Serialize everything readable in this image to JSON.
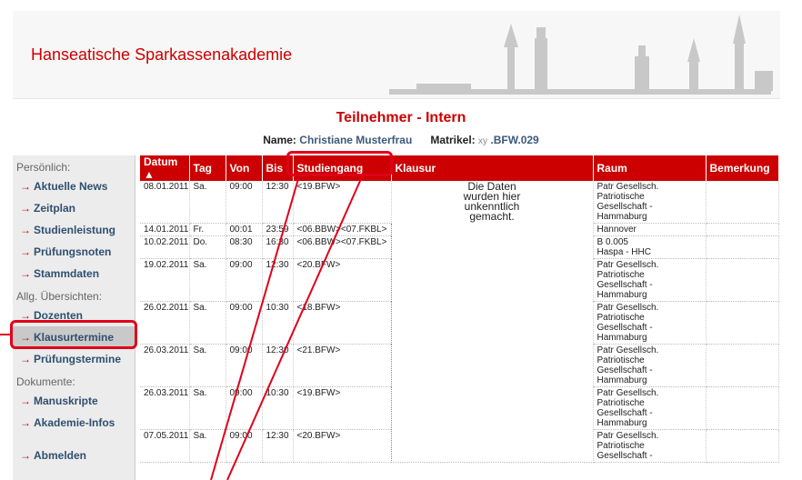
{
  "header": {
    "brand": "Hanseatische Sparkassenakademie"
  },
  "page_title": "Teilnehmer - Intern",
  "participant": {
    "name_label": "Name:",
    "name_value": "Christiane Musterfrau",
    "matrikel_label": "Matrikel:",
    "matrikel_prefix": "xy",
    "matrikel_value": ".BFW.029"
  },
  "sidebar": {
    "section_personal": "Persönlich:",
    "personal_items": [
      "Aktuelle News",
      "Zeitplan",
      "Studienleistung",
      "Prüfungsnoten",
      "Stammdaten"
    ],
    "section_overview": "Allg. Übersichten:",
    "overview_items": [
      "Dozenten",
      "Klausurtermine",
      "Prüfungstermine"
    ],
    "section_docs": "Dokumente:",
    "doc_items": [
      "Manuskripte",
      "Akademie-Infos"
    ],
    "logout": "Abmelden",
    "arrow": "→"
  },
  "table": {
    "headers": [
      "Datum ▲",
      "Tag",
      "Von",
      "Bis",
      "Studiengang",
      "Klausur",
      "Raum",
      "Bemerkung"
    ],
    "klausur_note": [
      "Die Daten",
      "wurden hier",
      "unkenntlich",
      "gemacht."
    ],
    "rows": [
      {
        "datum": "08.01.2011",
        "tag": "Sa.",
        "von": "09:00",
        "bis": "12:30",
        "studiengang": "<19.BFW>",
        "raum": [
          "Patr Gesellsch.",
          "Patriotische",
          "Gesellschaft -",
          "Hammaburg"
        ]
      },
      {
        "datum": "14.01.2011",
        "tag": "Fr.",
        "von": "00:01",
        "bis": "23:59",
        "studiengang": "<06.BBW><07.FKBL>",
        "raum": [
          "Hannover"
        ]
      },
      {
        "datum": "10.02.2011",
        "tag": "Do.",
        "von": "08:30",
        "bis": "16:30",
        "studiengang": "<06.BBW><07.FKBL>",
        "raum": [
          "B 0.005",
          "Haspa - HHC"
        ]
      },
      {
        "datum": "19.02.2011",
        "tag": "Sa.",
        "von": "09:00",
        "bis": "12:30",
        "studiengang": "<20.BFW>",
        "raum": [
          "Patr Gesellsch.",
          "Patriotische",
          "Gesellschaft -",
          "Hammaburg"
        ]
      },
      {
        "datum": "26.02.2011",
        "tag": "Sa.",
        "von": "09:00",
        "bis": "10:30",
        "studiengang": "<18.BFW>",
        "raum": [
          "Patr Gesellsch.",
          "Patriotische",
          "Gesellschaft -",
          "Hammaburg"
        ]
      },
      {
        "datum": "26.03.2011",
        "tag": "Sa.",
        "von": "09:00",
        "bis": "12:30",
        "studiengang": "<21.BFW>",
        "raum": [
          "Patr Gesellsch.",
          "Patriotische",
          "Gesellschaft -",
          "Hammaburg"
        ]
      },
      {
        "datum": "26.03.2011",
        "tag": "Sa.",
        "von": "09:00",
        "bis": "10:30",
        "studiengang": "<19.BFW>",
        "raum": [
          "Patr Gesellsch.",
          "Patriotische",
          "Gesellschaft -",
          "Hammaburg"
        ]
      },
      {
        "datum": "07.05.2011",
        "tag": "Sa.",
        "von": "09:00",
        "bis": "12:30",
        "studiengang": "<20.BFW>",
        "raum": [
          "Patr Gesellsch.",
          "Patriotische",
          "Gesellschaft -"
        ]
      }
    ]
  },
  "colors": {
    "brand_red": "#cc0000",
    "nav_blue": "#2f4f6f",
    "annotation_red": "#e0001a"
  }
}
